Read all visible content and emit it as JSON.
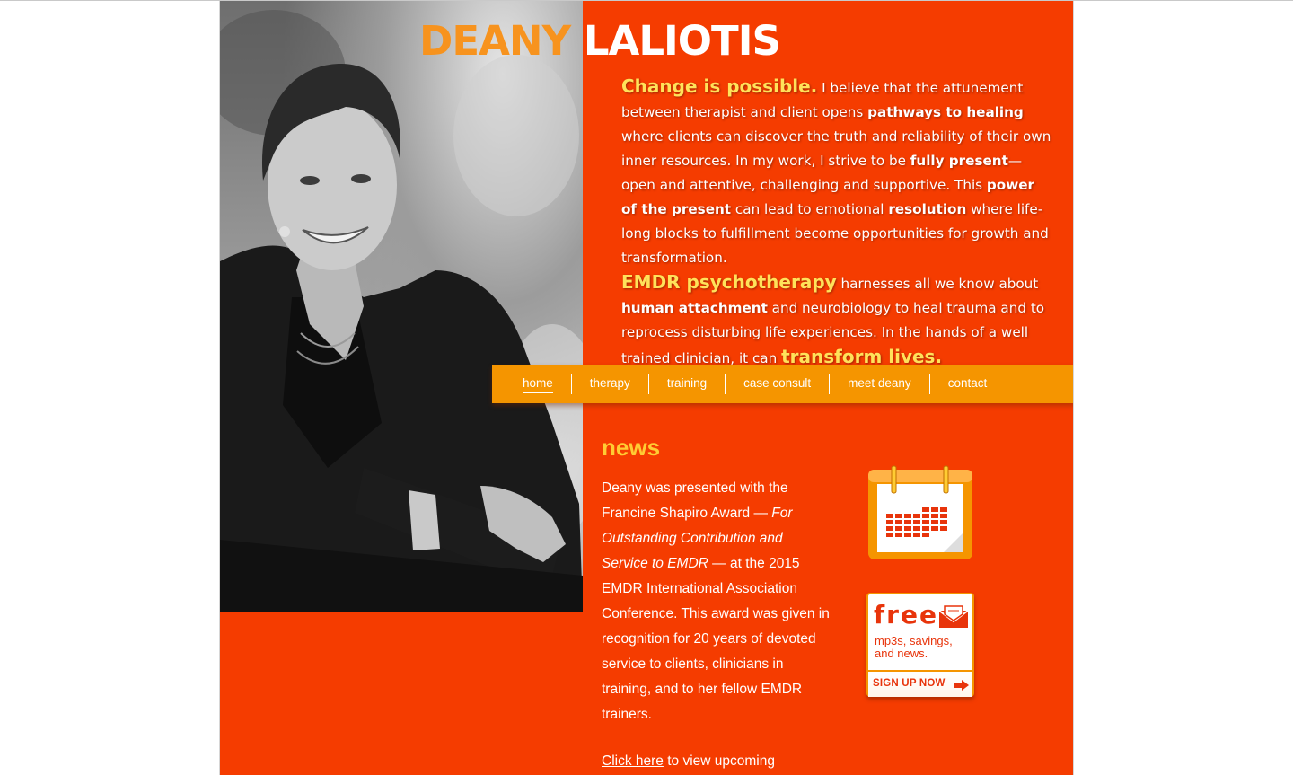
{
  "brand": {
    "first_name": "DEANY",
    "last_name": "LALIOTIS"
  },
  "intro": {
    "p1": [
      {
        "t": "Change is possible.",
        "s": "hl"
      },
      {
        "t": " I believe that the attunement between therapist and client opens ",
        "s": ""
      },
      {
        "t": "pathways to healing",
        "s": "b"
      },
      {
        "t": " where clients can discover the truth and reliability of their own inner resources. In my work, I strive to be ",
        "s": ""
      },
      {
        "t": "fully present",
        "s": "b"
      },
      {
        "t": "—open and attentive, challenging and supportive. This ",
        "s": ""
      },
      {
        "t": "power of the present",
        "s": "b"
      },
      {
        "t": " can lead to emotional ",
        "s": ""
      },
      {
        "t": "resolution",
        "s": "b"
      },
      {
        "t": " where life-long blocks to fulfillment become opportunities for growth and transformation.",
        "s": ""
      }
    ],
    "p2": [
      {
        "t": "EMDR psychotherapy",
        "s": "hl"
      },
      {
        "t": " harnesses all we know about ",
        "s": ""
      },
      {
        "t": "human attachment",
        "s": "b"
      },
      {
        "t": " and neurobiology to heal trauma and to reprocess disturbing life experiences. In the hands of a well trained clinician, it can ",
        "s": ""
      },
      {
        "t": "transform lives.",
        "s": "hl"
      }
    ]
  },
  "nav": {
    "items": [
      {
        "label": "home",
        "active": true
      },
      {
        "label": "therapy",
        "active": false
      },
      {
        "label": "training",
        "active": false
      },
      {
        "label": "case consult",
        "active": false
      },
      {
        "label": "meet deany",
        "active": false
      },
      {
        "label": "contact",
        "active": false
      }
    ]
  },
  "news": {
    "heading": "news",
    "body": [
      {
        "t": "Deany was presented with the Francine Shapiro Award — ",
        "s": ""
      },
      {
        "t": "For Outstanding Contribution and Service to EMDR",
        "s": "i"
      },
      {
        "t": " — at the 2015 EMDR International Association Conference. This award was given in recognition for 20 years of devoted service to clients, clinicians in training, and to her fellow EMDR trainers.",
        "s": ""
      }
    ],
    "link_label": "Click here",
    "link_suffix": " to view upcoming"
  },
  "widgets": {
    "calendar_icon": "calendar-icon",
    "free": {
      "title": "free",
      "envelope_icon": "envelope-icon",
      "subtitle": "mp3s, savings, and news.",
      "cta": "SIGN UP NOW",
      "arrow_icon": "arrow-right-icon"
    }
  },
  "colors": {
    "background": "#f53c00",
    "nav": "#f59500",
    "highlight": "#ffe25a",
    "news_heading": "#ffcc33",
    "brand_first": "#f7931e"
  }
}
